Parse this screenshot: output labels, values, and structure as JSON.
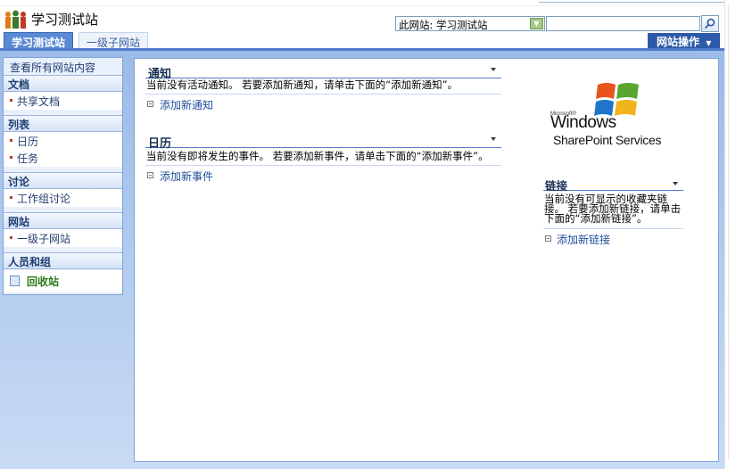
{
  "header": {
    "site_title": "学习测试站",
    "search_scope": "此网站: 学习测试站",
    "search_placeholder": "",
    "search_icon": "search-icon"
  },
  "tabs": {
    "active": "学习测试站",
    "other": "一级子网站",
    "site_actions": "网站操作"
  },
  "quicklaunch": {
    "view_all": "查看所有网站内容",
    "sections": [
      {
        "title": "文档",
        "items": [
          "共享文档"
        ]
      },
      {
        "title": "列表",
        "items": [
          "日历",
          "任务"
        ]
      },
      {
        "title": "讨论",
        "items": [
          "工作组讨论"
        ]
      },
      {
        "title": "网站",
        "items": [
          "一级子网站"
        ]
      },
      {
        "title": "人员和组",
        "items": []
      }
    ],
    "recycle_bin": "回收站"
  },
  "webparts": {
    "announcements": {
      "title": "通知",
      "body": "当前没有活动通知。 若要添加新通知，请单击下面的“添加新通知”。",
      "add": "添加新通知"
    },
    "calendar": {
      "title": "日历",
      "body": "当前没有即将发生的事件。 若要添加新事件，请单击下面的“添加新事件”。",
      "add": "添加新事件"
    },
    "links": {
      "title": "链接",
      "body": "当前没有可显示的收藏夹链接。 若要添加新链接，请单击下面的“添加新链接”。",
      "add": "添加新链接"
    }
  },
  "logo": {
    "microsoft": "Microsoft®",
    "windows": "Windows",
    "sharepoint": "SharePoint Services"
  },
  "colors": {
    "tab_active": "#5a8ad3",
    "site_actions_bg": "#2d5aa8",
    "page_gradient_top": "#9bbbe8",
    "page_gradient_bottom": "#c9dbf4"
  }
}
